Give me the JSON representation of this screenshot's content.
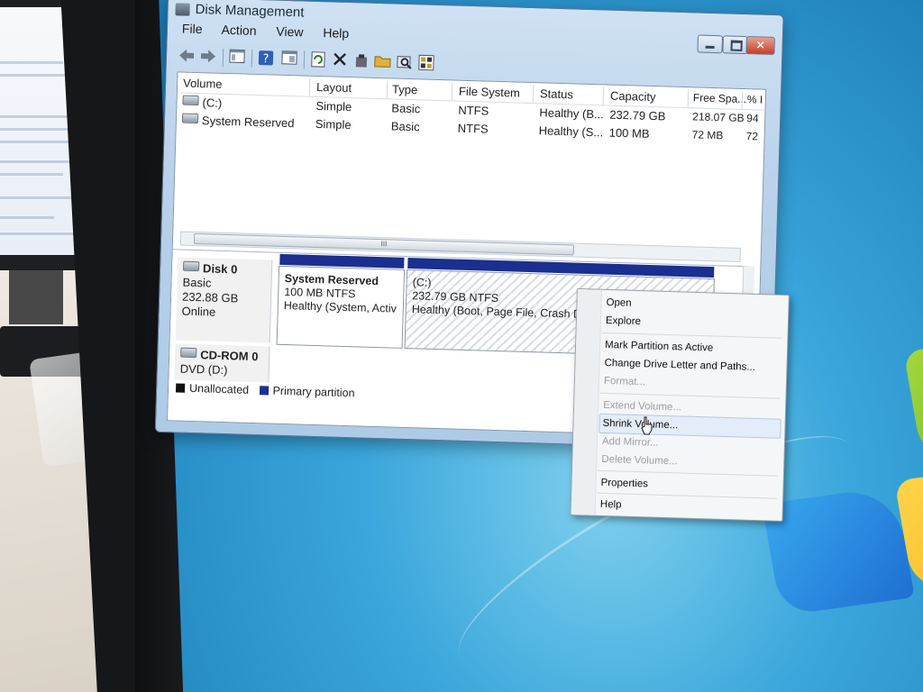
{
  "window": {
    "title": "Disk Management",
    "close_glyph": "✕"
  },
  "menubar": [
    "File",
    "Action",
    "View",
    "Help"
  ],
  "toolbar_icons": [
    "back-icon",
    "forward-icon",
    "show-hide-console-tree-icon",
    "help-icon",
    "properties-icon",
    "refresh-icon",
    "delete-icon",
    "properties-sheet-icon",
    "open-folder-icon",
    "search-icon",
    "check-disk-icon"
  ],
  "volume_list": {
    "columns": [
      "Volume",
      "Layout",
      "Type",
      "File System",
      "Status",
      "Capacity",
      "Free Spa...",
      "% I"
    ],
    "rows": [
      {
        "volume": "(C:)",
        "layout": "Simple",
        "type": "Basic",
        "fs": "NTFS",
        "status": "Healthy (B...",
        "capacity": "232.79 GB",
        "free": "218.07 GB",
        "pct": "94"
      },
      {
        "volume": "System Reserved",
        "layout": "Simple",
        "type": "Basic",
        "fs": "NTFS",
        "status": "Healthy (S...",
        "capacity": "100 MB",
        "free": "72 MB",
        "pct": "72"
      }
    ],
    "scroll_thumb_glyph": "III"
  },
  "disks": [
    {
      "name": "Disk 0",
      "kind": "Basic",
      "size": "232.88 GB",
      "state": "Online",
      "partitions": [
        {
          "title": "System Reserved",
          "size": "100 MB NTFS",
          "status": "Healthy (System, Activ"
        },
        {
          "title": "(C:)",
          "size": "232.79 GB NTFS",
          "status": "Healthy (Boot, Page File, Crash Dı"
        }
      ]
    },
    {
      "name": "CD-ROM 0",
      "kind": "DVD (D:)"
    }
  ],
  "legend": [
    {
      "label": "Unallocated",
      "color": "#111111"
    },
    {
      "label": "Primary partition",
      "color": "#1a2f8f"
    }
  ],
  "context_menu": {
    "items": [
      {
        "label": "Open",
        "enabled": true
      },
      {
        "label": "Explore",
        "enabled": true
      },
      {
        "label": "Mark Partition as Active",
        "enabled": true
      },
      {
        "label": "Change Drive Letter and Paths...",
        "enabled": true
      },
      {
        "label": "Format...",
        "enabled": false
      },
      {
        "label": "Extend Volume...",
        "enabled": false
      },
      {
        "label": "Shrink Volume...",
        "enabled": true,
        "hover": true
      },
      {
        "label": "Add Mirror...",
        "enabled": false
      },
      {
        "label": "Delete Volume...",
        "enabled": false
      },
      {
        "label": "Properties",
        "enabled": true
      },
      {
        "label": "Help",
        "enabled": true
      }
    ]
  }
}
